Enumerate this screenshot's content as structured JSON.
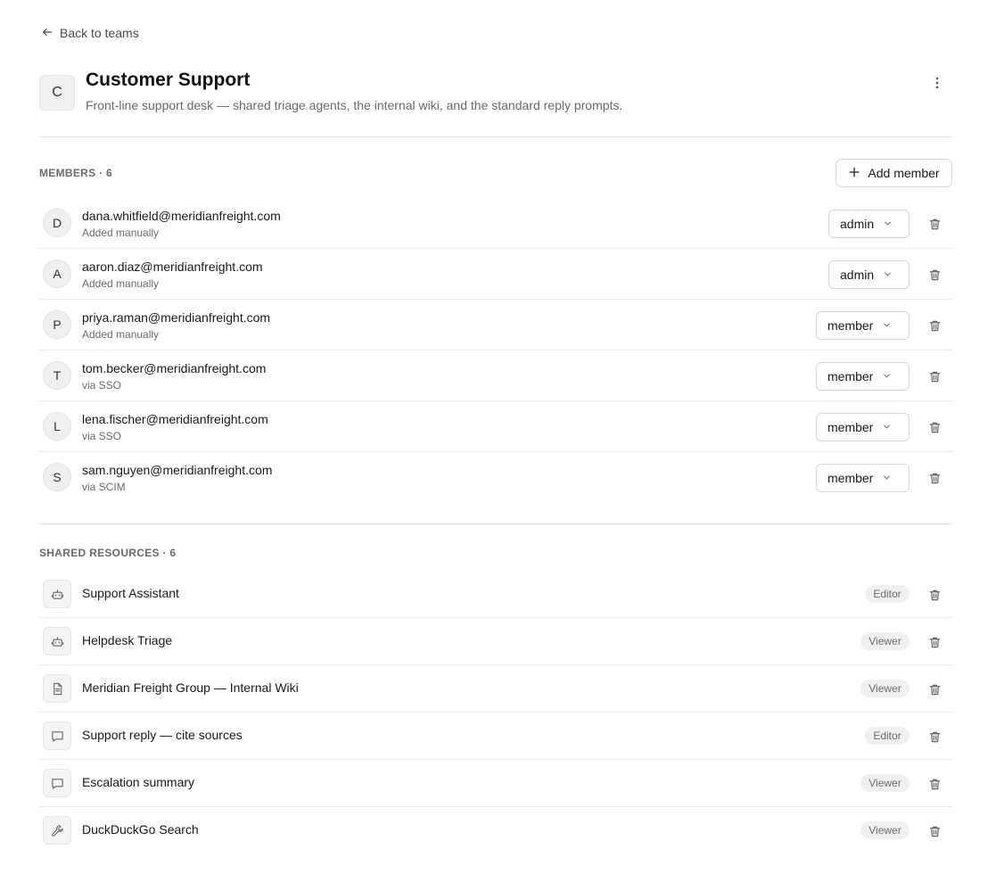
{
  "nav": {
    "back_label": "Back to teams"
  },
  "team": {
    "initial": "C",
    "name": "Customer Support",
    "description": "Front-line support desk — shared triage agents, the internal wiki, and the standard reply prompts."
  },
  "members": {
    "section_label": "MEMBERS · 6",
    "add_button_label": "Add member",
    "items": [
      {
        "initial": "D",
        "email": "dana.whitfield@meridianfreight.com",
        "source": "Added manually",
        "role": "admin"
      },
      {
        "initial": "A",
        "email": "aaron.diaz@meridianfreight.com",
        "source": "Added manually",
        "role": "admin"
      },
      {
        "initial": "P",
        "email": "priya.raman@meridianfreight.com",
        "source": "Added manually",
        "role": "member"
      },
      {
        "initial": "T",
        "email": "tom.becker@meridianfreight.com",
        "source": "via SSO",
        "role": "member"
      },
      {
        "initial": "L",
        "email": "lena.fischer@meridianfreight.com",
        "source": "via SSO",
        "role": "member"
      },
      {
        "initial": "S",
        "email": "sam.nguyen@meridianfreight.com",
        "source": "via SCIM",
        "role": "member"
      }
    ]
  },
  "resources": {
    "section_label": "SHARED RESOURCES · 6",
    "items": [
      {
        "icon": "bot-icon",
        "name": "Support Assistant",
        "permission": "Editor"
      },
      {
        "icon": "bot-icon",
        "name": "Helpdesk Triage",
        "permission": "Viewer"
      },
      {
        "icon": "document-icon",
        "name": "Meridian Freight Group — Internal Wiki",
        "permission": "Viewer"
      },
      {
        "icon": "chat-bubble-icon",
        "name": "Support reply — cite sources",
        "permission": "Editor"
      },
      {
        "icon": "chat-bubble-icon",
        "name": "Escalation summary",
        "permission": "Viewer"
      },
      {
        "icon": "wrench-icon",
        "name": "DuckDuckGo Search",
        "permission": "Viewer"
      }
    ]
  }
}
